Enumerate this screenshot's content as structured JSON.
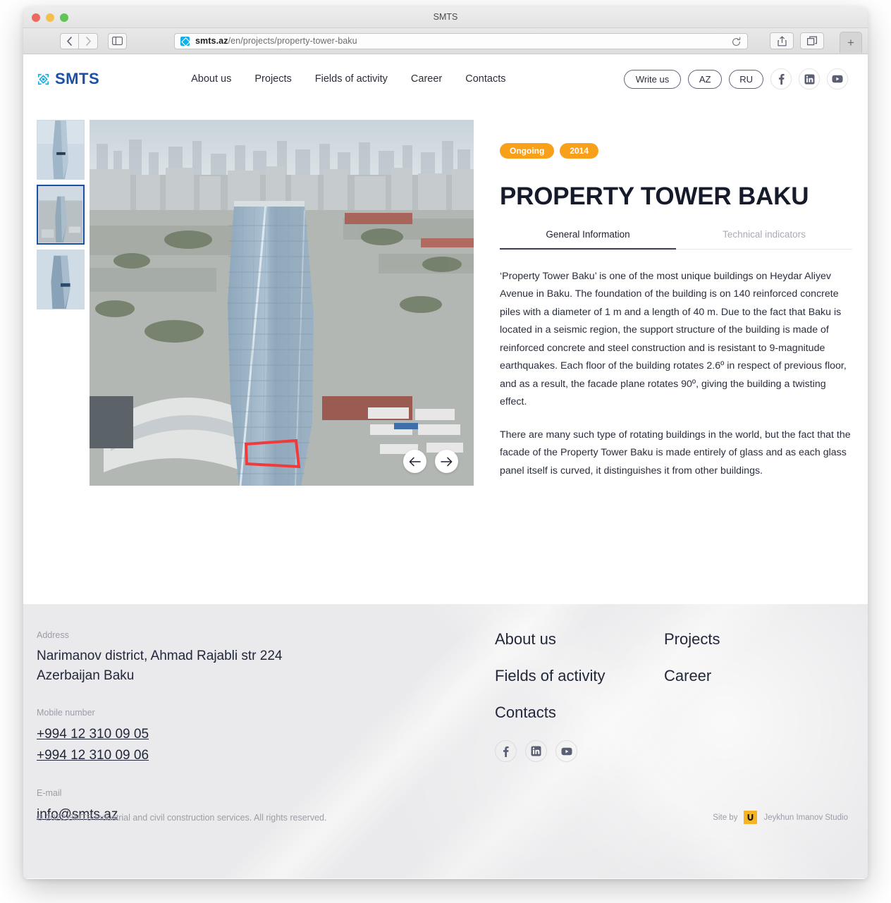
{
  "browser": {
    "window_title": "SMTS",
    "url_domain": "smts.az",
    "url_path": "/en/projects/property-tower-baku",
    "back_label": "‹",
    "forward_label": "›",
    "reload_label": "⟳",
    "new_tab_label": "+"
  },
  "header": {
    "logo_text": "SMTS",
    "nav": [
      {
        "label": "About us"
      },
      {
        "label": "Projects"
      },
      {
        "label": "Fields of activity"
      },
      {
        "label": "Career"
      },
      {
        "label": "Contacts"
      }
    ],
    "write_us": "Write us",
    "lang_az": "AZ",
    "lang_ru": "RU",
    "social": [
      {
        "name": "facebook-icon",
        "glyph": "f"
      },
      {
        "name": "linkedin-icon",
        "glyph": "in"
      },
      {
        "name": "youtube-icon",
        "glyph": "▶"
      }
    ]
  },
  "project": {
    "badges": [
      "Ongoing",
      "2014"
    ],
    "title": "PROPERTY TOWER BAKU",
    "tabs": [
      {
        "label": "General Information",
        "active": true
      },
      {
        "label": "Technical indicators",
        "active": false
      }
    ],
    "paragraphs": [
      "‘Property Tower Baku’ is one of the most unique buildings on Heydar Aliyev Avenue in Baku. The foundation of the building is on 140 reinforced concrete piles with a diameter of 1 m and a length of 40 m. Due to the fact that Baku is located in a seismic region, the support structure of the building is made of reinforced concrete and steel construction and is resistant to 9-magnitude earthquakes. Each floor of the building rotates 2.6º in respect of previous floor, and as a result, the facade plane rotates 90º, giving the building a twisting effect.",
      "There are many such type of rotating buildings in the world, but the fact that the facade of the Property Tower Baku is made entirely of glass and as each glass panel itself is curved, it distinguishes it from other buildings."
    ],
    "carousel": {
      "prev": "←",
      "next": "→"
    },
    "thumbnails": [
      {
        "name": "thumbnail-1",
        "active": false
      },
      {
        "name": "thumbnail-2",
        "active": true
      },
      {
        "name": "thumbnail-3",
        "active": false
      }
    ]
  },
  "footer": {
    "address_label": "Address",
    "address_value": "Narimanov district, Ahmad Rajabli str 224\nAzerbaijan Baku",
    "address_line1": "Narimanov district, Ahmad Rajabli str 224",
    "address_line2": "Azerbaijan Baku",
    "mobile_label": "Mobile number",
    "phone_1": "+994 12 310 09 05",
    "phone_2": "+994 12 310 09 06",
    "email_label": "E-mail",
    "email": "info@smts.az",
    "nav_col1": [
      {
        "label": "About us"
      },
      {
        "label": "Fields of activity"
      },
      {
        "label": "Contacts"
      }
    ],
    "nav_col2": [
      {
        "label": "Projects"
      },
      {
        "label": "Career"
      }
    ],
    "social": [
      {
        "name": "facebook-icon",
        "glyph": "f"
      },
      {
        "name": "linkedin-icon",
        "glyph": "in"
      },
      {
        "name": "youtube-icon",
        "glyph": "▶"
      }
    ],
    "copyright": "© 2022 SMTS Industrial and civil construction services. All rights reserved.",
    "site_by_label": "Site by",
    "site_by_studio": "Jeykhun Imanov Studio"
  },
  "colors": {
    "brand_blue": "#1b51a4",
    "brand_cyan": "#12b0e8",
    "badge_orange": "#f9a01b",
    "footer_bg": "#eaeaec",
    "text_dark": "#23273a",
    "studio_yellow": "#f5b521"
  }
}
